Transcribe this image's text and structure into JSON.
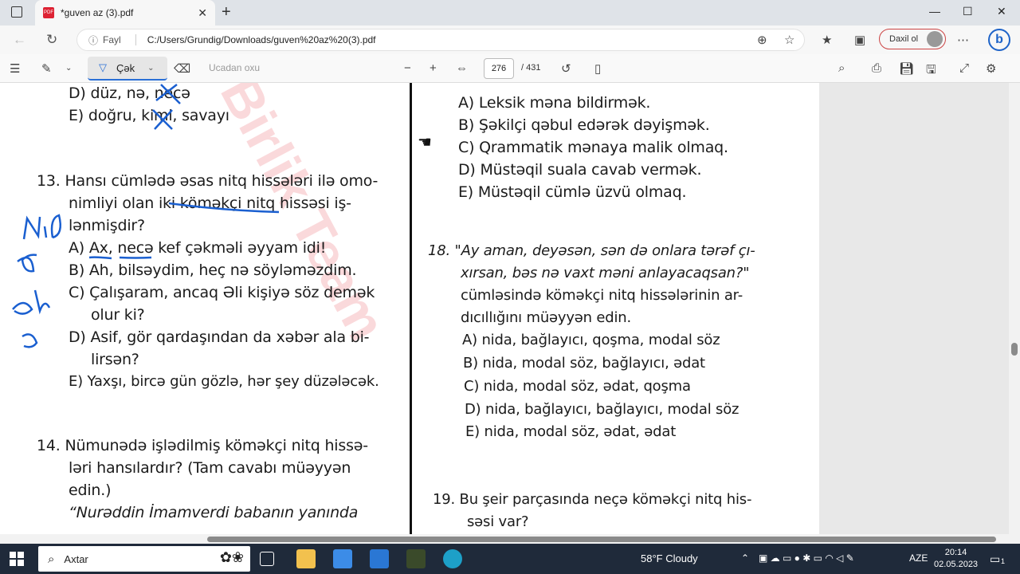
{
  "browser": {
    "tab_title": "*guven az (3).pdf",
    "tab_close": "✕",
    "new_tab": "+",
    "minimize": "—",
    "restore": "☐",
    "close": "✕",
    "info_label": "Fayl",
    "url": "C:/Users/Grundig/Downloads/guven%20az%20(3).pdf",
    "signin_label": "Daxil ol"
  },
  "pdf_toolbar": {
    "draw_label": "Çək",
    "read_aloud_label": "Ucadan oxu",
    "page_current": "276",
    "page_total": "/ 431"
  },
  "page": {
    "left_lines": [
      "D) düz, nə, necə",
      "E) doğru, kimi, savayı",
      "13.  Hansı cümlədə əsas nitq hissələri ilə omo-",
      "nimliyi olan iki köməkçi nitq hissəsi iş-",
      "lənmişdir?",
      "A) Ax, necə kef çəkməli əyyam idi!",
      "B) Ah, bilsəydim, heç nə söyləməzdim.",
      "C) Çalışaram, ancaq Əli kişiyə söz demək",
      "olur ki?",
      "D) Asif, gör qardaşından da xəbər ala bi-",
      "lirsən?",
      "E) Yaxşı, bircə gün gözlə, hər şey düzələcək.",
      "14.  Nümunədə işlədilmiş köməkçi nitq hissə-",
      "ləri hansılardır? (Tam cavabı müəyyən",
      "edin.)",
      "“Nurəddin İmamverdi babanın yanında"
    ],
    "right_lines": [
      "A) Leksik məna bildirmək.",
      "B) Şəkilçi qəbul edərək dəyişmək.",
      "C) Qrammatik mənaya malik olmaq.",
      "D) Müstəqil suala cavab vermək.",
      "E) Müstəqil cümlə üzvü olmaq.",
      "18.  \"Ay aman, deyəsən, sən də onlara tərəf çı-",
      "xırsan, bəs nə vaxt məni anlayacaqsan?\"",
      "cümləsində köməkçi nitq hissələrinin ar-",
      "dıcıllığını müəyyən edin.",
      "A) nida, bağlayıcı, qoşma, modal söz",
      "B) nida, modal söz, bağlayıcı, ədat",
      "C) nida, modal söz, ədat, qoşma",
      "D) nida, bağlayıcı, bağlayıcı, modal söz",
      "E) nida, modal söz, ədat, ədat",
      "19.  Bu şeir parçasında neçə köməkçi nitq his-",
      "səsi var?"
    ],
    "watermark": "Birlik Team"
  },
  "taskbar": {
    "search_placeholder": "Axtar",
    "weather": "58°F  Cloudy",
    "language": "AZE",
    "time": "20:14",
    "date": "02.05.2023",
    "notification_count": "1"
  },
  "colors": {
    "accent": "#2a6fd6",
    "annotation_ink": "#1a5fd0",
    "watermark": "#e6505a"
  }
}
